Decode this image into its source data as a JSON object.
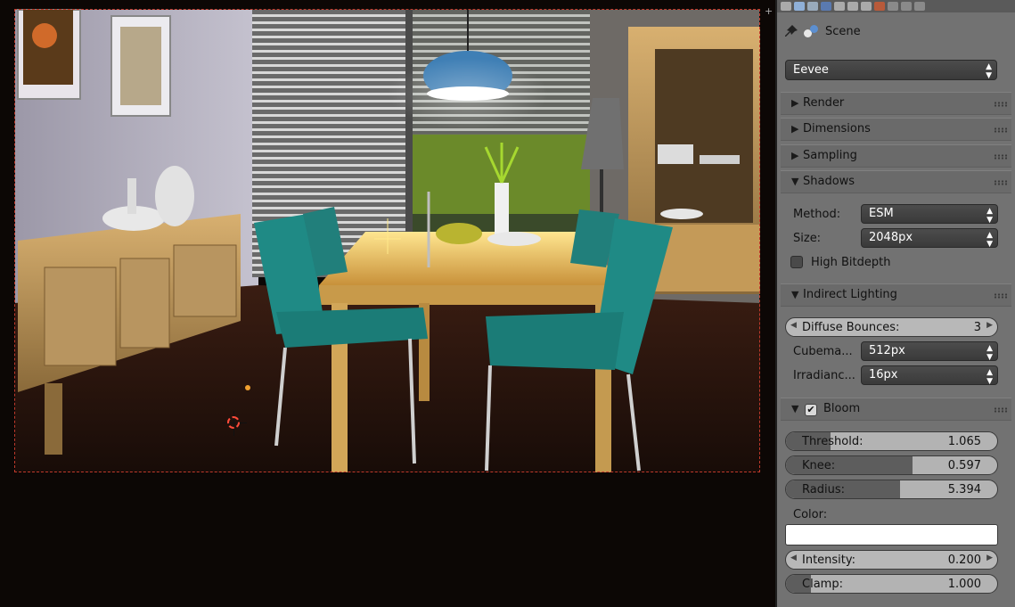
{
  "breadcrumb": {
    "scene_label": "Scene"
  },
  "render_engine": {
    "value": "Eevee"
  },
  "panels": {
    "render": "Render",
    "dimensions": "Dimensions",
    "sampling": "Sampling",
    "shadows": {
      "title": "Shadows",
      "method_label": "Method:",
      "method_value": "ESM",
      "size_label": "Size:",
      "size_value": "2048px",
      "high_bitdepth_label": "High Bitdepth"
    },
    "indirect_lighting": {
      "title": "Indirect Lighting",
      "diffuse_bounces_label": "Diffuse Bounces:",
      "diffuse_bounces_value": "3",
      "cubemap_label": "Cubema...",
      "cubemap_value": "512px",
      "irradiance_label": "Irradianc...",
      "irradiance_value": "16px"
    },
    "bloom": {
      "title": "Bloom",
      "enabled": true,
      "threshold_label": "Threshold:",
      "threshold_value": "1.065",
      "knee_label": "Knee:",
      "knee_value": "0.597",
      "radius_label": "Radius:",
      "radius_value": "5.394",
      "color_label": "Color:",
      "color_value": "#ffffff",
      "intensity_label": "Intensity:",
      "intensity_value": "0.200",
      "clamp_label": "Clamp:",
      "clamp_value": "1.000"
    }
  },
  "colors": {
    "panel_bg": "#727272",
    "widget_dark": "#3f3f3f",
    "camera_frame": "#c0392b",
    "lamp_blue": "#3f7fb5",
    "chair_teal": "#1f8a85"
  }
}
